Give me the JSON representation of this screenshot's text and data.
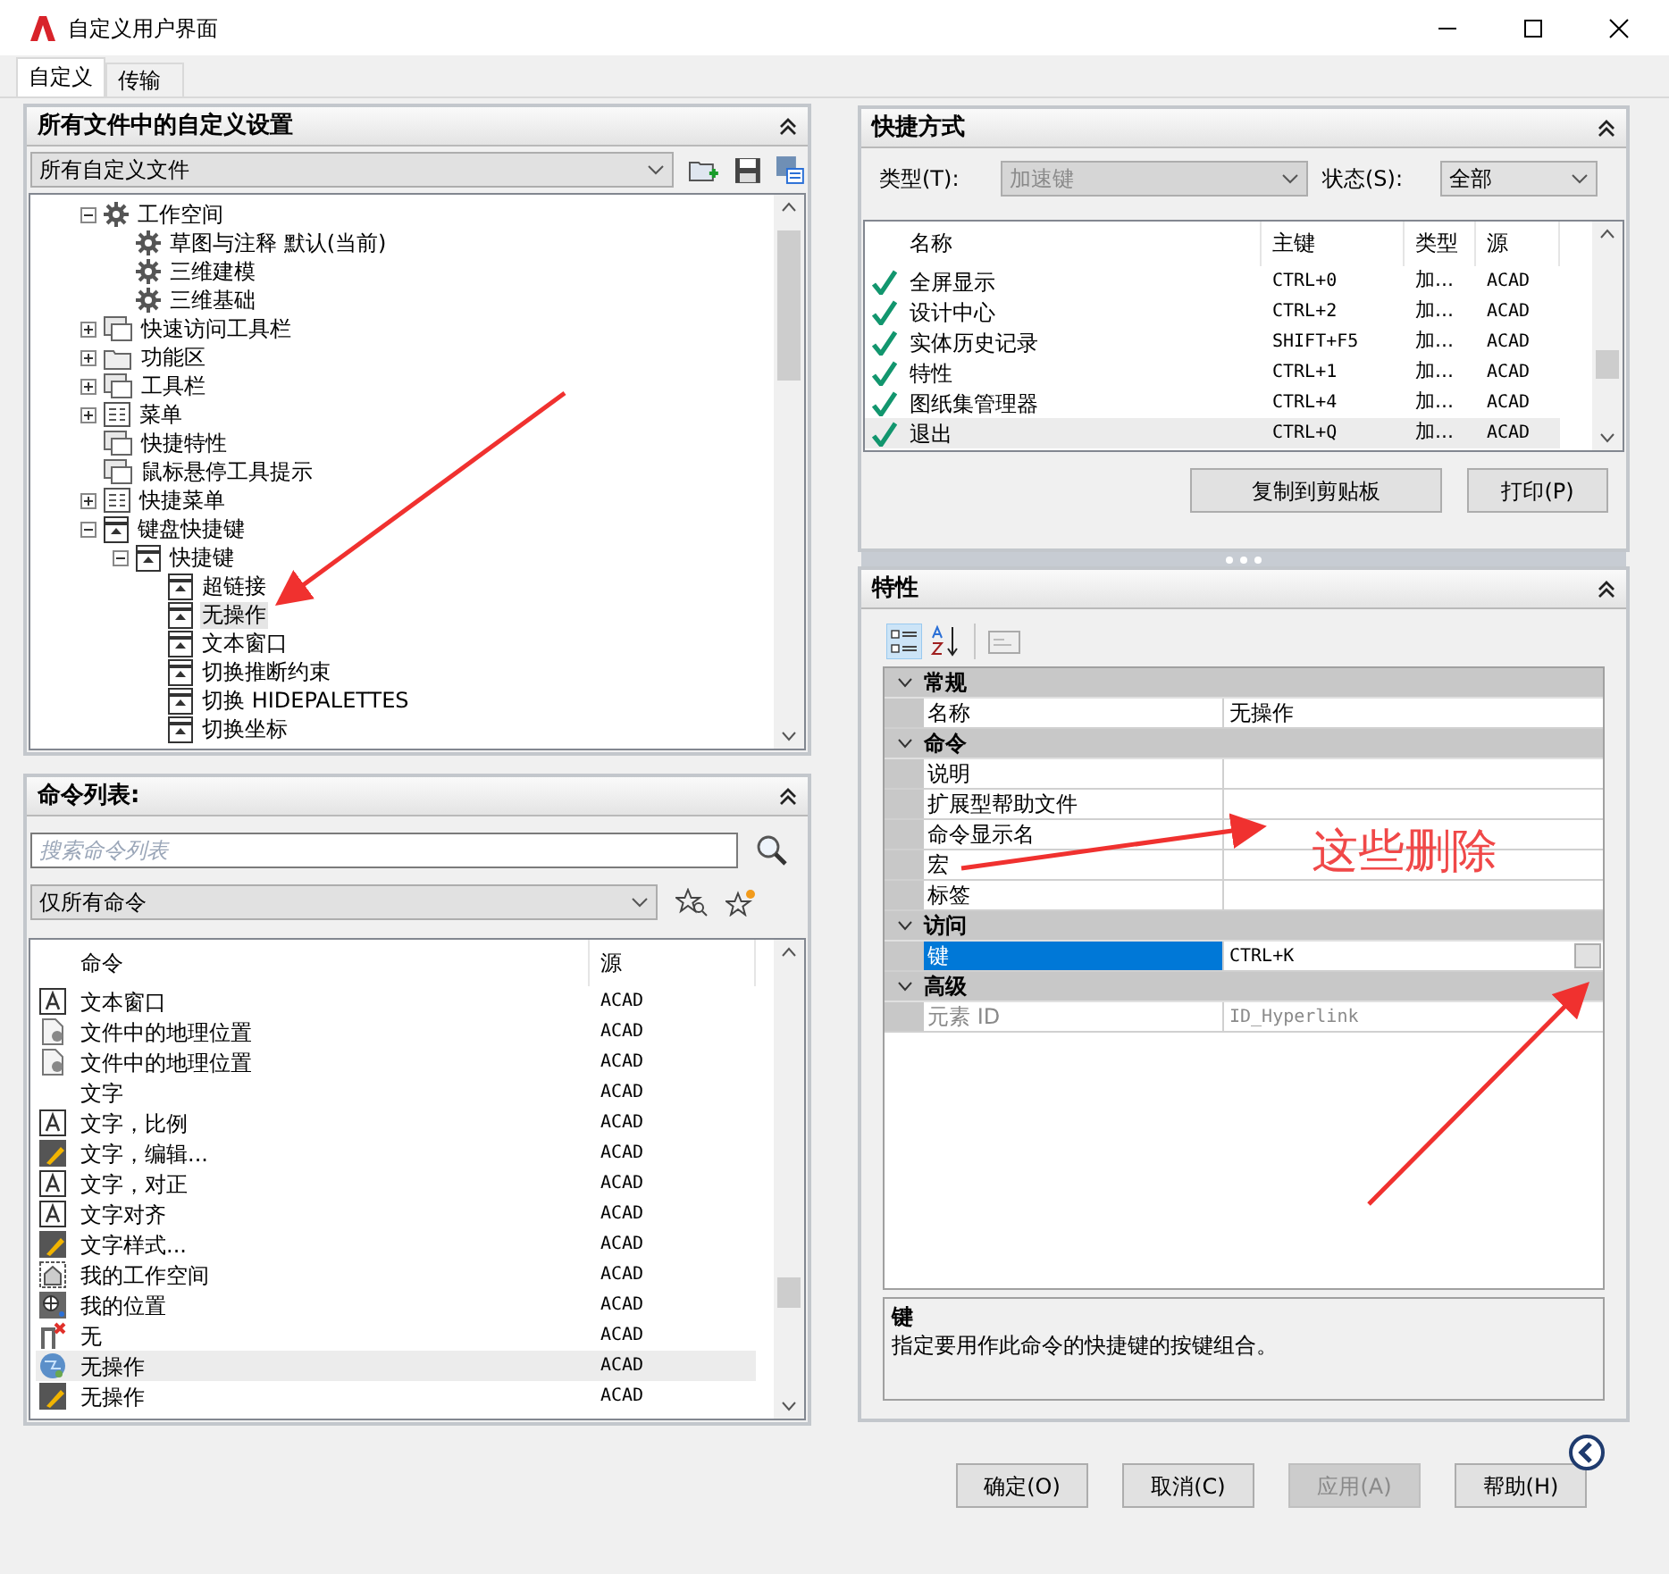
{
  "window": {
    "title": "自定义用户界面"
  },
  "tabs": [
    {
      "label": "自定义",
      "selected": true
    },
    {
      "label": "传输",
      "selected": false
    }
  ],
  "customizations_panel": {
    "title": "所有文件中的自定义设置",
    "file_select": "所有自定义文件",
    "tree": [
      {
        "label": "工作空间",
        "kind": "gear",
        "expanded": true,
        "selected": false,
        "children": [
          {
            "label": "草图与注释 默认(当前)",
            "kind": "gear",
            "selected": false
          },
          {
            "label": "三维建模",
            "kind": "gear",
            "selected": false
          },
          {
            "label": "三维基础",
            "kind": "gear",
            "selected": false
          }
        ]
      },
      {
        "label": "快速访问工具栏",
        "kind": "panel",
        "expanded": false,
        "selected": false
      },
      {
        "label": "功能区",
        "kind": "folder",
        "expanded": false,
        "selected": false
      },
      {
        "label": "工具栏",
        "kind": "panel",
        "expanded": false,
        "selected": false
      },
      {
        "label": "菜单",
        "kind": "menu",
        "expanded": false,
        "selected": false
      },
      {
        "label": "快捷特性",
        "kind": "panel",
        "selected": false
      },
      {
        "label": "鼠标悬停工具提示",
        "kind": "panel",
        "selected": false
      },
      {
        "label": "快捷菜单",
        "kind": "menu",
        "expanded": false,
        "selected": false
      },
      {
        "label": "键盘快捷键",
        "kind": "key",
        "expanded": true,
        "selected": false,
        "children": [
          {
            "label": "快捷键",
            "kind": "key",
            "expanded": true,
            "selected": false,
            "children": [
              {
                "label": "超链接",
                "kind": "key",
                "selected": false
              },
              {
                "label": "无操作",
                "kind": "key",
                "selected": true
              },
              {
                "label": "文本窗口",
                "kind": "key",
                "selected": false
              },
              {
                "label": "切换推断约束",
                "kind": "key",
                "selected": false
              },
              {
                "label": "切换 HIDEPALETTES",
                "kind": "key",
                "selected": false
              },
              {
                "label": "切换坐标",
                "kind": "key",
                "selected": false
              }
            ]
          }
        ]
      }
    ]
  },
  "command_panel": {
    "title": "命令列表:",
    "search": {
      "placeholder": "搜索命令列表"
    },
    "filter": "仅所有命令",
    "columns": [
      "命令",
      "源"
    ],
    "rows": [
      {
        "name": "文本窗口",
        "source": "ACAD",
        "kind": "letter",
        "selected": false
      },
      {
        "name": "文件中的地理位置",
        "source": "ACAD",
        "kind": "document",
        "selected": false
      },
      {
        "name": "文件中的地理位置",
        "source": "ACAD",
        "kind": "document",
        "selected": false
      },
      {
        "name": "文字",
        "source": "ACAD",
        "kind": "none",
        "selected": false
      },
      {
        "name": "文字，比例",
        "source": "ACAD",
        "kind": "letter",
        "selected": false
      },
      {
        "name": "文字，编辑...",
        "source": "ACAD",
        "kind": "pen",
        "selected": false
      },
      {
        "name": "文字，对正",
        "source": "ACAD",
        "kind": "letter",
        "selected": false
      },
      {
        "name": "文字对齐",
        "source": "ACAD",
        "kind": "letter",
        "selected": false
      },
      {
        "name": "文字样式...",
        "source": "ACAD",
        "kind": "pen",
        "selected": false
      },
      {
        "name": "我的工作空间",
        "source": "ACAD",
        "kind": "house",
        "selected": false
      },
      {
        "name": "我的位置",
        "source": "ACAD",
        "kind": "target",
        "selected": false
      },
      {
        "name": "无",
        "source": "ACAD",
        "kind": "cross",
        "selected": false
      },
      {
        "name": "无操作",
        "source": "ACAD",
        "kind": "globe",
        "selected": true
      },
      {
        "name": "无操作",
        "source": "ACAD",
        "kind": "pen",
        "selected": false
      }
    ]
  },
  "shortcuts_panel": {
    "title": "快捷方式",
    "type_label": "类型(T):",
    "type_value": "加速键",
    "type_disabled": true,
    "status_label": "状态(S):",
    "status_value": "全部",
    "columns": [
      "名称",
      "主键",
      "类型",
      "源"
    ],
    "rows": [
      {
        "name": "全屏显示",
        "key": "CTRL+0",
        "type": "加...",
        "source": "ACAD",
        "selected": false
      },
      {
        "name": "设计中心",
        "key": "CTRL+2",
        "type": "加...",
        "source": "ACAD",
        "selected": false
      },
      {
        "name": "实体历史记录",
        "key": "SHIFT+F5",
        "type": "加...",
        "source": "ACAD",
        "selected": false
      },
      {
        "name": "特性",
        "key": "CTRL+1",
        "type": "加...",
        "source": "ACAD",
        "selected": false
      },
      {
        "name": "图纸集管理器",
        "key": "CTRL+4",
        "type": "加...",
        "source": "ACAD",
        "selected": false
      },
      {
        "name": "退出",
        "key": "CTRL+Q",
        "type": "加...",
        "source": "ACAD",
        "selected": true
      }
    ],
    "buttons": [
      "复制到剪贴板",
      "打印(P)"
    ]
  },
  "properties_panel": {
    "title": "特性",
    "categories": [
      {
        "name": "常规",
        "expanded": true,
        "rows": [
          {
            "name": "名称",
            "value": "无操作",
            "selected": false,
            "disabled": false
          }
        ]
      },
      {
        "name": "命令",
        "expanded": true,
        "rows": [
          {
            "name": "说明",
            "selected": false,
            "disabled": false
          },
          {
            "name": "扩展型帮助文件",
            "selected": false,
            "disabled": false
          },
          {
            "name": "命令显示名",
            "selected": false,
            "disabled": false
          },
          {
            "name": "宏",
            "selected": false,
            "disabled": false
          },
          {
            "name": "标签",
            "selected": false,
            "disabled": false
          }
        ]
      },
      {
        "name": "访问",
        "expanded": true,
        "rows": [
          {
            "name": "键",
            "value": "CTRL+K",
            "selected": true,
            "disabled": false
          }
        ]
      },
      {
        "name": "高级",
        "expanded": true,
        "rows": [
          {
            "name": "元素 ID",
            "value": "ID_Hyperlink",
            "selected": false,
            "disabled": true
          }
        ]
      }
    ],
    "help": {
      "title": "键",
      "text": "指定要用作此命令的快捷键的按键组合。"
    }
  },
  "annotation": {
    "text": "这些删除"
  },
  "buttons": [
    {
      "label": "确定(O)",
      "disabled": false
    },
    {
      "label": "取消(C)",
      "disabled": false
    },
    {
      "label": "应用(A)",
      "disabled": true
    },
    {
      "label": "帮助(H)",
      "disabled": false
    }
  ]
}
